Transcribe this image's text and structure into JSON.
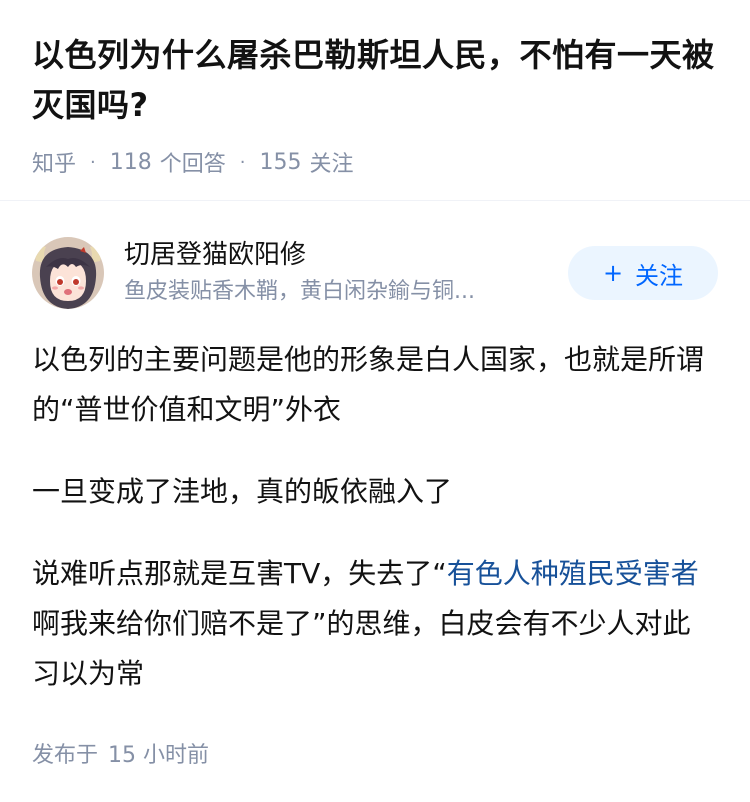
{
  "question": {
    "title": "以色列为什么屠杀巴勒斯坦人民，不怕有一天被灭国吗?",
    "source": "知乎",
    "answer_count": "118",
    "answer_label": "个回答",
    "follower_count": "155",
    "follower_label": "关注",
    "separator": "·"
  },
  "author": {
    "name": "切居登猫欧阳修",
    "bio": "鱼皮装贴香木鞘，黄白闲杂鍮与铜...",
    "avatar_icon": "anime-avatar-icon",
    "follow_label": "关注",
    "follow_icon": "+"
  },
  "answer": {
    "paragraph1": "以色列的主要问题是他的形象是白人国家，也就是所谓的“普世价值和文明”外衣",
    "paragraph2": "一旦变成了洼地，真的皈依融入了",
    "paragraph3_prefix": "说难听点那就是互害TV，失去了“",
    "paragraph3_link": "有色人种殖民受害者",
    "paragraph3_suffix": "啊我来给你们赔不是了”的思维，白皮会有不少人对此习以为常"
  },
  "footer": {
    "publish_label": "发布于",
    "publish_time": "15 小时前"
  },
  "colors": {
    "text": "#121212",
    "meta": "#8590a6",
    "link": "#175199",
    "follow_bg": "#ebf5ff",
    "follow_text": "#0066ff"
  }
}
